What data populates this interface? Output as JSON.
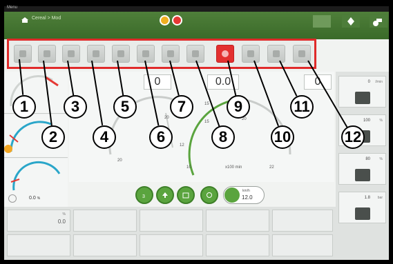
{
  "window": {
    "title": "Menu"
  },
  "header": {
    "breadcrumb": "Cereal > Mod",
    "mode_icons": [
      "speedometer-icon",
      "gear-warning-icon"
    ],
    "right_buttons": [
      "keyboard-icon",
      "pin-icon",
      "tractor-icon"
    ]
  },
  "toolbar": {
    "buttons": [
      {
        "id": "1",
        "icon": "tool-icon"
      },
      {
        "id": "2",
        "icon": "tool-icon"
      },
      {
        "id": "3",
        "icon": "tool-icon"
      },
      {
        "id": "4",
        "icon": "tool-icon"
      },
      {
        "id": "5",
        "icon": "tool-icon"
      },
      {
        "id": "6",
        "icon": "tool-icon"
      },
      {
        "id": "7",
        "icon": "tool-icon"
      },
      {
        "id": "8",
        "icon": "tool-icon"
      },
      {
        "id": "9",
        "icon": "record-icon",
        "active": true
      },
      {
        "id": "10",
        "icon": "tool-icon"
      },
      {
        "id": "11",
        "icon": "tool-icon"
      },
      {
        "id": "12",
        "icon": "tool-icon"
      }
    ],
    "highlight_color": "#e02a2a",
    "active_color": "#e3302f"
  },
  "callouts": [
    "1",
    "2",
    "3",
    "4",
    "5",
    "6",
    "7",
    "8",
    "9",
    "10",
    "11",
    "12"
  ],
  "center": {
    "readout_left": "0",
    "readout_mid": "0.0",
    "readout_right": "0",
    "scale_labels": {
      "top_left": "20",
      "top_mid": "15",
      "top_right": "20",
      "mid_left": "12",
      "mid_right": "15",
      "low": "20",
      "low2": "10",
      "right": "22"
    },
    "unit_mid": "x100 min"
  },
  "left_panel": {
    "value": "0.0",
    "unit": "%"
  },
  "bottom_bar": {
    "buttons": [
      "gear-3-icon",
      "arrow-up-icon",
      "camera-icon",
      "pto-icon",
      "cruise-icon"
    ],
    "gear_label": "3",
    "speed": {
      "unit": "km/h",
      "value": "12.0"
    }
  },
  "right_panel": {
    "cards": [
      {
        "value": "0",
        "unit": "l/min"
      },
      {
        "value": "100",
        "unit": "%"
      },
      {
        "value": "80",
        "unit": "%"
      },
      {
        "value": "1.8",
        "unit": "bar"
      }
    ]
  },
  "grid": {
    "first_value": "0.0",
    "first_unit": "%"
  },
  "colors": {
    "header_green": "#4a7a36",
    "accent_green": "#5aa43e",
    "frame": "#000000"
  }
}
